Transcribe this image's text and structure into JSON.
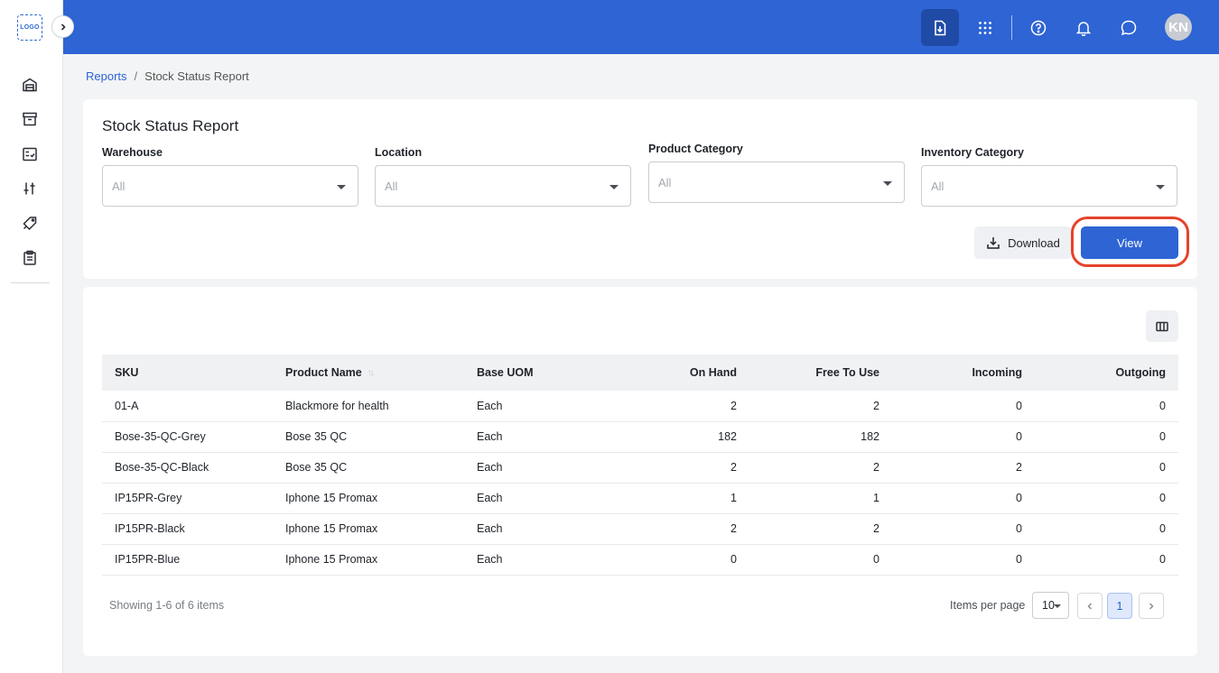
{
  "sidebar": {
    "logo_text": "LOGO",
    "icons": [
      "warehouse-icon",
      "archive-icon",
      "checklist-icon",
      "adjustments-icon",
      "tags-icon",
      "clipboard-icon"
    ]
  },
  "header": {
    "avatar_initials": "KN",
    "icons": [
      "download-report-icon",
      "apps-grid-icon",
      "help-icon",
      "bell-icon",
      "chat-icon"
    ]
  },
  "breadcrumb": {
    "parent": "Reports",
    "separator": "/",
    "current": "Stock Status Report"
  },
  "filters": {
    "title": "Stock Status Report",
    "warehouse": {
      "label": "Warehouse",
      "value": "All"
    },
    "location": {
      "label": "Location",
      "value": "All"
    },
    "product_category": {
      "label": "Product Category",
      "value": "All"
    },
    "inventory_category": {
      "label": "Inventory Category",
      "value": "All"
    },
    "download_label": "Download",
    "view_label": "View"
  },
  "table": {
    "columns": {
      "sku": "SKU",
      "product_name": "Product Name",
      "base_uom": "Base UOM",
      "on_hand": "On Hand",
      "free_to_use": "Free To Use",
      "incoming": "Incoming",
      "outgoing": "Outgoing"
    },
    "rows": [
      {
        "sku": "01-A",
        "product_name": "Blackmore for health",
        "base_uom": "Each",
        "on_hand": "2",
        "free_to_use": "2",
        "incoming": "0",
        "outgoing": "0"
      },
      {
        "sku": "Bose-35-QC-Grey",
        "product_name": "Bose 35 QC",
        "base_uom": "Each",
        "on_hand": "182",
        "free_to_use": "182",
        "incoming": "0",
        "outgoing": "0"
      },
      {
        "sku": "Bose-35-QC-Black",
        "product_name": "Bose 35 QC",
        "base_uom": "Each",
        "on_hand": "2",
        "free_to_use": "2",
        "incoming": "2",
        "outgoing": "0"
      },
      {
        "sku": "IP15PR-Grey",
        "product_name": "Iphone 15 Promax",
        "base_uom": "Each",
        "on_hand": "1",
        "free_to_use": "1",
        "incoming": "0",
        "outgoing": "0"
      },
      {
        "sku": "IP15PR-Black",
        "product_name": "Iphone 15 Promax",
        "base_uom": "Each",
        "on_hand": "2",
        "free_to_use": "2",
        "incoming": "0",
        "outgoing": "0"
      },
      {
        "sku": "IP15PR-Blue",
        "product_name": "Iphone 15 Promax",
        "base_uom": "Each",
        "on_hand": "0",
        "free_to_use": "0",
        "incoming": "0",
        "outgoing": "0"
      }
    ]
  },
  "pagination": {
    "showing_text": "Showing 1-6 of 6 items",
    "items_per_page_label": "Items per page",
    "items_per_page_value": "10",
    "current_page": "1"
  },
  "colors": {
    "primary": "#2e64d4",
    "highlight_ring": "#e5432a"
  }
}
